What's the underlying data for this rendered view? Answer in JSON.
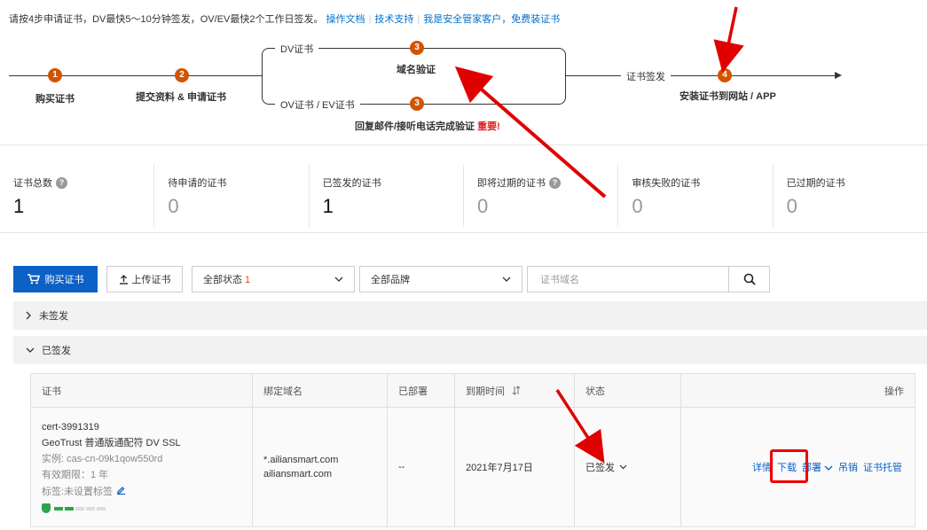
{
  "intro": {
    "text": "请按4步申请证书，DV最快5～10分钟签发，OV/EV最快2个工作日签发。",
    "link_docs": "操作文档",
    "link_support": "技术支持",
    "link_free": "我是安全管家客户，免费装证书"
  },
  "flow": {
    "step1": {
      "num": "1",
      "label": "购买证书"
    },
    "step2": {
      "num": "2",
      "label": "提交资料 & 申请证书"
    },
    "branch_dv_tag": "DV证书",
    "branch_ovev_tag": "OV证书 / EV证书",
    "step3a": {
      "num": "3",
      "label": "域名验证"
    },
    "step3b": {
      "num": "3",
      "label": "回复邮件/接听电话完成验证",
      "important": "重要!"
    },
    "issue_tag": "证书签发",
    "step4": {
      "num": "4",
      "label": "安装证书到网站 / APP"
    }
  },
  "stats": [
    {
      "label": "证书总数",
      "value": "1",
      "has_help": true
    },
    {
      "label": "待申请的证书",
      "value": "0",
      "has_help": false
    },
    {
      "label": "已签发的证书",
      "value": "1",
      "has_help": false
    },
    {
      "label": "即将过期的证书",
      "value": "0",
      "has_help": true
    },
    {
      "label": "审核失败的证书",
      "value": "0",
      "has_help": false
    },
    {
      "label": "已过期的证书",
      "value": "0",
      "has_help": false
    }
  ],
  "toolbar": {
    "buy_label": "购买证书",
    "upload_label": "上传证书",
    "status_select": "全部状态",
    "status_count": "1",
    "brand_select": "全部品牌",
    "search_placeholder": "证书域名"
  },
  "groups": {
    "unsigned": "未签发",
    "signed": "已签发"
  },
  "table": {
    "headers": {
      "cert": "证书",
      "domain": "绑定域名",
      "deployed": "已部署",
      "expire": "到期时间",
      "status": "状态",
      "ops": "操作"
    },
    "row": {
      "cert_id": "cert-3991319",
      "cert_name": "GeoTrust 普通版通配符 DV SSL",
      "instance": "实例: cas-cn-09k1qow550rd",
      "validity": "有效期限：1 年",
      "tag": "标签:未设置标签",
      "domain1": "*.ailiansmart.com",
      "domain2": "ailiansmart.com",
      "deployed": "--",
      "expire": "2021年7月17日",
      "status": "已签发",
      "op_detail": "详情",
      "op_download": "下载",
      "op_deploy": "部署",
      "op_revoke": "吊销",
      "op_trust": "证书托管"
    }
  },
  "colors": {
    "primary": "#0b61c6",
    "step": "#d35400",
    "annotation": "#e00000"
  }
}
